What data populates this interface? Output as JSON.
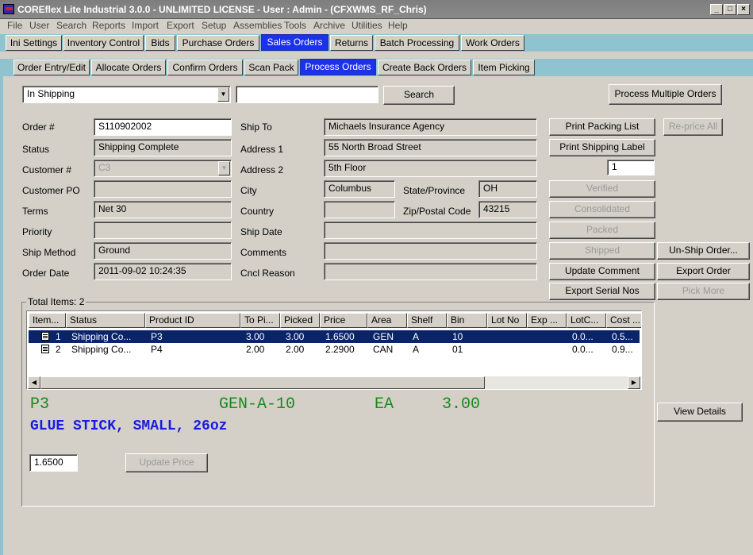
{
  "window": {
    "title": "COREflex Lite Industrial 3.0.0 - UNLIMITED LICENSE - User : Admin - (CFXWMS_RF_Chris)"
  },
  "menu": [
    "File",
    "User",
    "Search",
    "Reports",
    "Import",
    "Export",
    "Setup",
    "Assemblies",
    "Tools",
    "Archive",
    "Utilities",
    "Help"
  ],
  "main_tabs": [
    "Ini Settings",
    "Inventory Control",
    "Bids",
    "Purchase Orders",
    "Sales Orders",
    "Returns",
    "Batch Processing",
    "Work Orders"
  ],
  "sub_tabs": [
    "Order Entry/Edit",
    "Allocate Orders",
    "Confirm Orders",
    "Scan Pack",
    "Process Orders",
    "Create Back Orders",
    "Item Picking"
  ],
  "filter": {
    "status_value": "In Shipping",
    "search_value": "",
    "search_button": "Search",
    "process_multiple": "Process Multiple Orders"
  },
  "order": {
    "order_no_label": "Order #",
    "order_no": "S110902002",
    "status_label": "Status",
    "status": "Shipping Complete",
    "customer_label": "Customer #",
    "customer": "C3",
    "customer_po_label": "Customer PO",
    "customer_po": "",
    "terms_label": "Terms",
    "terms": "Net 30",
    "priority_label": "Priority",
    "priority": "",
    "ship_method_label": "Ship Method",
    "ship_method": "Ground",
    "order_date_label": "Order Date",
    "order_date": "2011-09-02 10:24:35"
  },
  "ship": {
    "ship_to_label": "Ship To",
    "ship_to": "Michaels Insurance Agency",
    "address1_label": "Address 1",
    "address1": "55 North Broad Street",
    "address2_label": "Address 2",
    "address2": "5th Floor",
    "city_label": "City",
    "city": "Columbus",
    "state_label": "State/Province",
    "state": "OH",
    "country_label": "Country",
    "country": "",
    "zip_label": "Zip/Postal Code",
    "zip": "43215",
    "ship_date_label": "Ship Date",
    "ship_date": "",
    "comments_label": "Comments",
    "comments": "",
    "cncl_label": "Cncl Reason",
    "cncl": ""
  },
  "actions": {
    "print_packing": "Print Packing List",
    "reprice_all": "Re-price All",
    "print_shipping": "Print Shipping Label",
    "label_copies": "1",
    "verified": "Verified",
    "consolidated": "Consolidated",
    "packed": "Packed",
    "shipped": "Shipped",
    "unship": "Un-Ship Order...",
    "update_comment": "Update Comment",
    "export_order": "Export Order",
    "export_serial": "Export Serial Nos",
    "pick_more": "Pick More",
    "view_details": "View Details",
    "update_price": "Update Price"
  },
  "items": {
    "total_label": "Total Items: 2",
    "columns": [
      "Item...",
      "Status",
      "Product ID",
      "To Pi...",
      "Picked",
      "Price",
      "Area",
      "Shelf",
      "Bin",
      "Lot No",
      "Exp ...",
      "LotC...",
      "Cost ..."
    ],
    "rows": [
      [
        "1",
        "Shipping Co...",
        "P3",
        "3.00",
        "3.00",
        "1.6500",
        "GEN",
        "A",
        "10",
        "",
        "",
        "0.0...",
        "0.5..."
      ],
      [
        "2",
        "Shipping Co...",
        "P4",
        "2.00",
        "2.00",
        "2.2900",
        "CAN",
        "A",
        "01",
        "",
        "",
        "0.0...",
        "0.9..."
      ]
    ]
  },
  "detail": {
    "product": "P3",
    "location": "GEN-A-10",
    "uom": "EA",
    "qty": "3.00",
    "description": "GLUE STICK, SMALL, 26oz",
    "price_value": "1.6500",
    "product_color": "#1a8a1a",
    "description_color": "#1a1ae0"
  }
}
